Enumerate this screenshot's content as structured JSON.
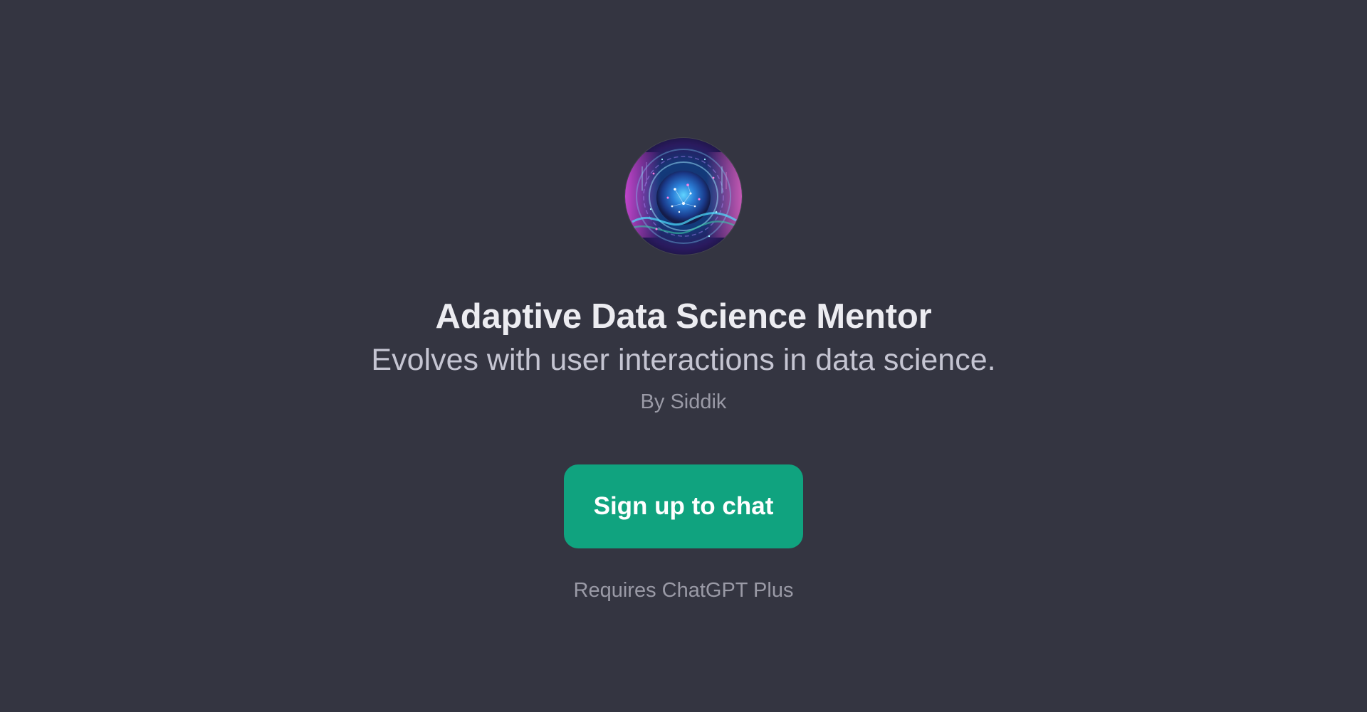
{
  "app": {
    "background_color": "#343541",
    "accent_color": "#10a37f"
  },
  "gpt": {
    "avatar_icon": "cosmic-data-orb-icon",
    "name": "Adaptive Data Science Mentor",
    "description": "Evolves with user interactions in data science.",
    "author": "By Siddik"
  },
  "actions": {
    "signup_label": "Sign up to chat",
    "requirement_note": "Requires ChatGPT Plus"
  }
}
